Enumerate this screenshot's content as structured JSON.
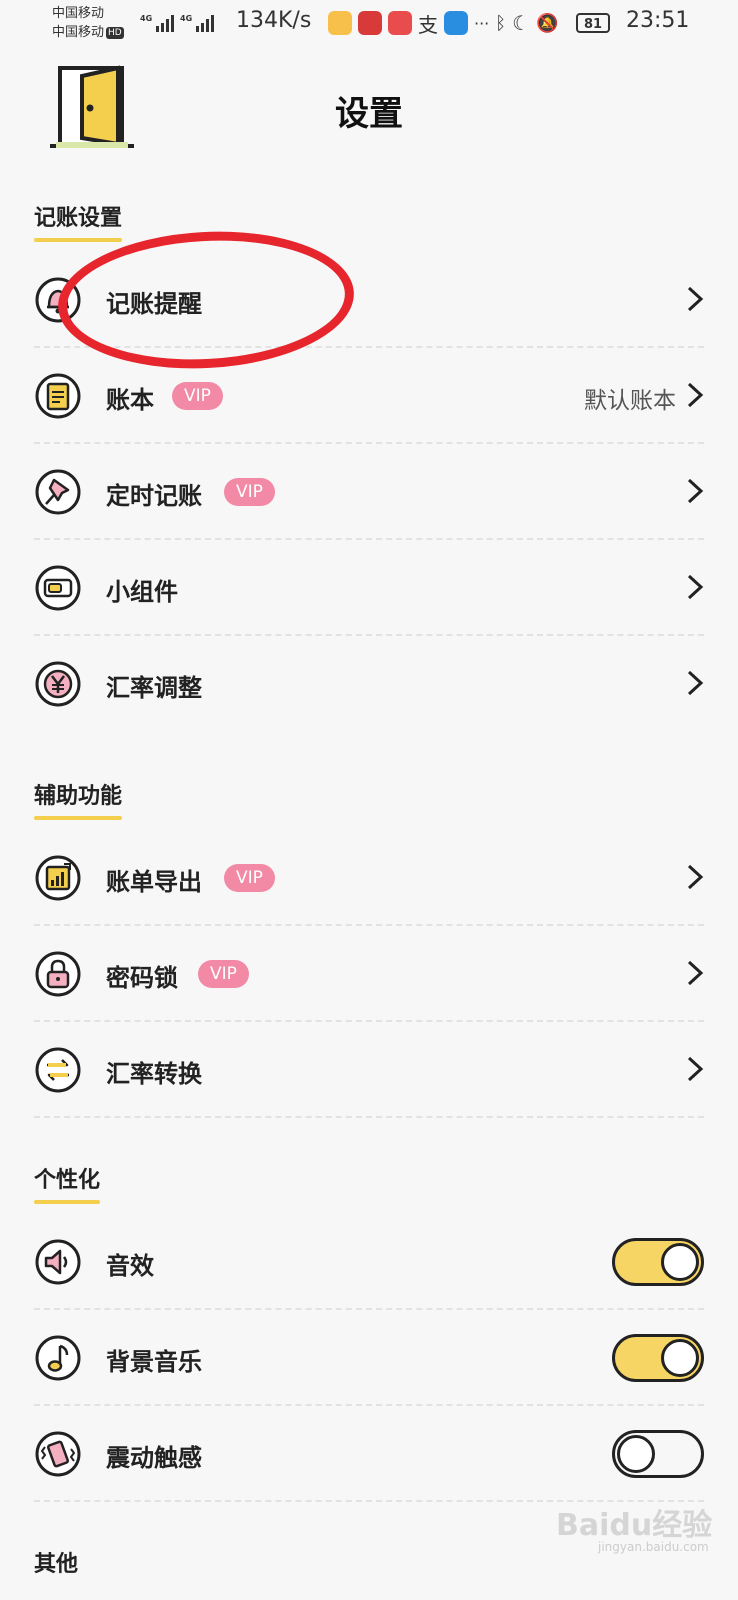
{
  "status_bar": {
    "carrier1": "中国移动",
    "carrier2": "中国移动",
    "hd": "HD",
    "net1": "4G",
    "net2": "4G",
    "speed": "134K/s",
    "battery": "81",
    "time": "23:51"
  },
  "header": {
    "title": "设置"
  },
  "sections": [
    {
      "title": "记账设置",
      "items": [
        {
          "label": "记账提醒",
          "icon": "bell-icon"
        },
        {
          "label": "账本",
          "vip": "VIP",
          "value": "默认账本",
          "icon": "ledger-icon"
        },
        {
          "label": "定时记账",
          "vip": "VIP",
          "icon": "pin-icon"
        },
        {
          "label": "小组件",
          "icon": "widget-icon"
        },
        {
          "label": "汇率调整",
          "icon": "yen-icon"
        }
      ]
    },
    {
      "title": "辅助功能",
      "items": [
        {
          "label": "账单导出",
          "vip": "VIP",
          "icon": "export-chart-icon"
        },
        {
          "label": "密码锁",
          "vip": "VIP",
          "icon": "lock-icon"
        },
        {
          "label": "汇率转换",
          "icon": "exchange-icon"
        }
      ]
    },
    {
      "title": "个性化",
      "items": [
        {
          "label": "音效",
          "toggle": true,
          "icon": "speaker-icon"
        },
        {
          "label": "背景音乐",
          "toggle": true,
          "icon": "music-note-icon"
        },
        {
          "label": "震动触感",
          "toggle": false,
          "icon": "vibrate-icon"
        }
      ]
    },
    {
      "title": "其他"
    }
  ],
  "watermark": {
    "text": "Baidu经验",
    "sub": "jingyan.baidu.com"
  },
  "colors": {
    "accent": "#f4cf4e",
    "vip": "#f28aa6",
    "annotation": "#e6252c"
  }
}
